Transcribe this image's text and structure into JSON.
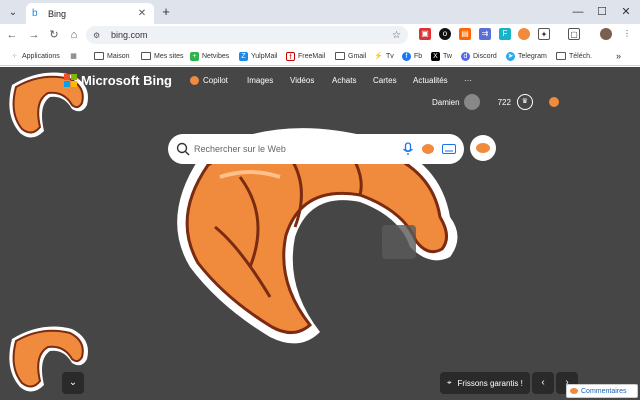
{
  "tab": {
    "title": "Bing",
    "favicon_icon": "bing-icon"
  },
  "toolbar": {
    "url": "bing.com"
  },
  "bookmarks": [
    {
      "label": "Applications",
      "icon": "apps-grid-icon"
    },
    {
      "label": "Maison",
      "icon": "folder-icon"
    },
    {
      "label": "Mes sites",
      "icon": "folder-icon"
    },
    {
      "label": "Netvibes",
      "icon": "netvibes-icon"
    },
    {
      "label": "YulpMail",
      "icon": "zimbra-icon"
    },
    {
      "label": "FreeMail",
      "icon": "freemail-icon"
    },
    {
      "label": "Gmail",
      "icon": "folder-icon"
    },
    {
      "label": "Tv",
      "icon": "tv-icon"
    },
    {
      "label": "Fb",
      "icon": "facebook-icon"
    },
    {
      "label": "Tw",
      "icon": "x-icon"
    },
    {
      "label": "Discord",
      "icon": "discord-icon"
    },
    {
      "label": "Telegram",
      "icon": "telegram-icon"
    },
    {
      "label": "Téléch.",
      "icon": "folder-icon"
    }
  ],
  "bing": {
    "logo_text": "Microsoft Bing",
    "nav": [
      "Copilot",
      "Images",
      "Vidéos",
      "Achats",
      "Cartes",
      "Actualités"
    ],
    "more": "···",
    "user_name": "Damien",
    "rewards_points": "722",
    "search_placeholder": "Rechercher sur le Web",
    "frissons": "Frissons garantis !",
    "feedback": "Commentaires"
  },
  "colors": {
    "accent": "#1a73e8",
    "page_bg": "#464646",
    "croissant": "#f08a3c"
  }
}
